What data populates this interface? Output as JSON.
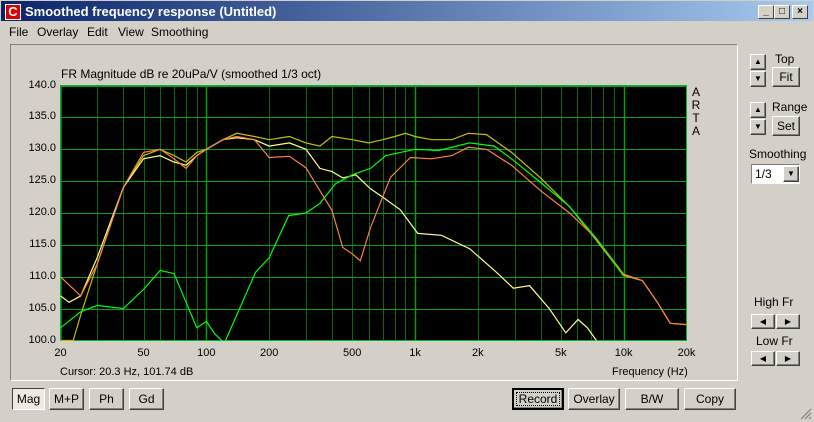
{
  "window": {
    "title": "Smoothed frequency response (Untitled)",
    "app_icon": "C",
    "minimize": "_",
    "maximize": "□",
    "close": "×"
  },
  "menu": [
    "File",
    "Overlay",
    "Edit",
    "View",
    "Smoothing"
  ],
  "graph": {
    "title": "FR Magnitude dB re 20uPa/V (smoothed 1/3 oct)",
    "brand": [
      "A",
      "R",
      "T",
      "A"
    ],
    "cursor": "Cursor: 20.3 Hz, 101.74 dB",
    "xlabel": "Frequency (Hz)"
  },
  "right_panel": {
    "top_label": "Top",
    "fit": "Fit",
    "range_label": "Range",
    "set": "Set",
    "smoothing_label": "Smoothing",
    "smoothing_value": "1/3",
    "high_fr": "High Fr",
    "low_fr": "Low Fr"
  },
  "bottom": {
    "mag": "Mag",
    "mp": "M+P",
    "ph": "Ph",
    "gd": "Gd",
    "record": "Record",
    "overlay": "Overlay",
    "bw": "B/W",
    "copy": "Copy"
  },
  "chart_data": {
    "type": "line",
    "title": "FR Magnitude dB re 20uPa/V (smoothed 1/3 oct)",
    "xlabel": "Frequency (Hz)",
    "ylabel": "dB",
    "xscale": "log",
    "xlim": [
      20,
      20000
    ],
    "ylim": [
      100,
      140
    ],
    "xticks": [
      {
        "v": 20,
        "l": "20"
      },
      {
        "v": 50,
        "l": "50"
      },
      {
        "v": 100,
        "l": "100"
      },
      {
        "v": 200,
        "l": "200"
      },
      {
        "v": 500,
        "l": "500"
      },
      {
        "v": 1000,
        "l": "1k"
      },
      {
        "v": 2000,
        "l": "2k"
      },
      {
        "v": 5000,
        "l": "5k"
      },
      {
        "v": 10000,
        "l": "10k"
      },
      {
        "v": 20000,
        "l": "20k"
      }
    ],
    "yticks": [
      "100.0",
      "105.0",
      "110.0",
      "115.0",
      "120.0",
      "125.0",
      "130.0",
      "135.0",
      "140.0"
    ],
    "grid": true,
    "series": [
      {
        "name": "dark-yellow",
        "color": "#c8c000",
        "points": [
          [
            20,
            100
          ],
          [
            23,
            100
          ],
          [
            25,
            104
          ],
          [
            30,
            112
          ],
          [
            40,
            124
          ],
          [
            50,
            129
          ],
          [
            60,
            130
          ],
          [
            70,
            129
          ],
          [
            80,
            128
          ],
          [
            90,
            129.5
          ],
          [
            100,
            130
          ],
          [
            120,
            131.5
          ],
          [
            140,
            132.5
          ],
          [
            170,
            132
          ],
          [
            200,
            131.5
          ],
          [
            250,
            132
          ],
          [
            300,
            131
          ],
          [
            350,
            130.5
          ],
          [
            400,
            132
          ],
          [
            500,
            131.5
          ],
          [
            600,
            131
          ],
          [
            700,
            131.5
          ],
          [
            800,
            132
          ],
          [
            900,
            132.5
          ],
          [
            1000,
            132
          ],
          [
            1200,
            131.5
          ],
          [
            1500,
            131.5
          ],
          [
            1800,
            132.5
          ],
          [
            2200,
            132.3
          ],
          [
            2900,
            129.5
          ],
          [
            4000,
            125.5
          ],
          [
            5500,
            121
          ],
          [
            7400,
            115.7
          ],
          [
            10000,
            110.2
          ],
          [
            12300,
            109.4
          ],
          [
            14500,
            106
          ],
          [
            16700,
            102.7
          ],
          [
            20000,
            102.5
          ]
        ]
      },
      {
        "name": "light-yellow",
        "color": "#ffff80",
        "points": [
          [
            20,
            107
          ],
          [
            22,
            106
          ],
          [
            25,
            107
          ],
          [
            30,
            113
          ],
          [
            40,
            124
          ],
          [
            50,
            128.5
          ],
          [
            60,
            129
          ],
          [
            70,
            128
          ],
          [
            80,
            127.5
          ],
          [
            90,
            129
          ],
          [
            100,
            130
          ],
          [
            120,
            131.5
          ],
          [
            140,
            131.8
          ],
          [
            170,
            131.5
          ],
          [
            200,
            130.5
          ],
          [
            250,
            131
          ],
          [
            300,
            130
          ],
          [
            350,
            127
          ],
          [
            400,
            126.5
          ],
          [
            450,
            125.5
          ],
          [
            520,
            126
          ],
          [
            612,
            123.8
          ],
          [
            700,
            122.5
          ],
          [
            850,
            120.5
          ],
          [
            1030,
            116.8
          ],
          [
            1340,
            116.5
          ],
          [
            1826,
            114.4
          ],
          [
            2400,
            111
          ],
          [
            2960,
            108.2
          ],
          [
            3540,
            108.6
          ],
          [
            4400,
            105
          ],
          [
            5280,
            101.2
          ],
          [
            6050,
            103.3
          ],
          [
            6700,
            102
          ],
          [
            7400,
            100
          ]
        ]
      },
      {
        "name": "orange",
        "color": "#ff8040",
        "points": [
          [
            20,
            110
          ],
          [
            25,
            107
          ],
          [
            30,
            112
          ],
          [
            40,
            124
          ],
          [
            50,
            129.5
          ],
          [
            60,
            130
          ],
          [
            70,
            128.5
          ],
          [
            80,
            127
          ],
          [
            90,
            129
          ],
          [
            100,
            130
          ],
          [
            120,
            131.5
          ],
          [
            140,
            132
          ],
          [
            170,
            131.5
          ],
          [
            200,
            128.7
          ],
          [
            250,
            128.9
          ],
          [
            300,
            127.1
          ],
          [
            350,
            123.5
          ],
          [
            400,
            120.4
          ],
          [
            450,
            114.6
          ],
          [
            500,
            113.6
          ],
          [
            547,
            112.5
          ],
          [
            612,
            117.7
          ],
          [
            763,
            125.6
          ],
          [
            950,
            128.7
          ],
          [
            1200,
            128.5
          ],
          [
            1500,
            129
          ],
          [
            1800,
            130.3
          ],
          [
            2200,
            130
          ],
          [
            2900,
            127.5
          ],
          [
            4000,
            123.5
          ],
          [
            5500,
            120
          ],
          [
            7400,
            116
          ],
          [
            10000,
            110.4
          ],
          [
            12300,
            109.4
          ],
          [
            14500,
            106
          ],
          [
            16700,
            102.7
          ],
          [
            20000,
            102.5
          ]
        ]
      },
      {
        "name": "green",
        "color": "#00ff00",
        "points": [
          [
            20,
            102
          ],
          [
            25,
            104.5
          ],
          [
            30,
            105.5
          ],
          [
            40,
            105
          ],
          [
            50,
            108
          ],
          [
            60,
            111
          ],
          [
            70,
            110.5
          ],
          [
            80,
            106
          ],
          [
            90,
            102
          ],
          [
            100,
            103
          ],
          [
            110,
            101
          ],
          [
            122,
            99.5
          ],
          [
            140,
            104
          ],
          [
            172,
            110.7
          ],
          [
            200,
            113
          ],
          [
            248,
            119.6
          ],
          [
            300,
            120
          ],
          [
            350,
            121.5
          ],
          [
            416,
            124.6
          ],
          [
            500,
            126
          ],
          [
            612,
            127
          ],
          [
            725,
            129
          ],
          [
            1000,
            130
          ],
          [
            1300,
            129.8
          ],
          [
            1826,
            131
          ],
          [
            2400,
            130.5
          ],
          [
            2900,
            128.5
          ],
          [
            4000,
            124.8
          ],
          [
            5500,
            121
          ],
          [
            7400,
            116
          ],
          [
            10000,
            110.1
          ]
        ]
      }
    ]
  }
}
